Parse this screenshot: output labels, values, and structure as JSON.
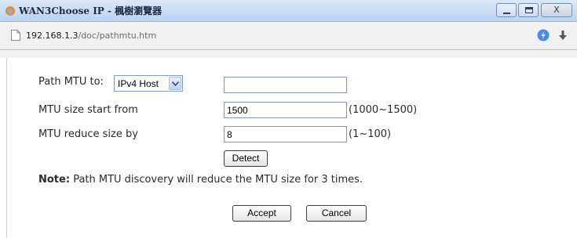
{
  "window": {
    "title": "WAN3Choose IP - 楓樹瀏覽器",
    "minimize_glyph": "",
    "close_glyph": "X"
  },
  "address": {
    "host": "192.168.1.3",
    "path": "/doc/pathmtu.htm"
  },
  "form": {
    "path_mtu_label": "Path MTU to:",
    "path_mtu_select": "IPv4 Host",
    "path_mtu_value": "",
    "start_label": "MTU size start from",
    "start_value": "1500",
    "start_range": "(1000~1500)",
    "reduce_label": "MTU reduce size by",
    "reduce_value": "8",
    "reduce_range": "(1~100)",
    "detect_label": "Detect"
  },
  "note": {
    "prefix": "Note:",
    "text": "Path MTU discovery will reduce the MTU size for 3 times."
  },
  "buttons": {
    "accept": "Accept",
    "cancel": "Cancel"
  },
  "colors": {
    "titlebar": "#c6dcf4",
    "input_border": "#7f9db9",
    "compat_icon": "#4a8ae8"
  }
}
